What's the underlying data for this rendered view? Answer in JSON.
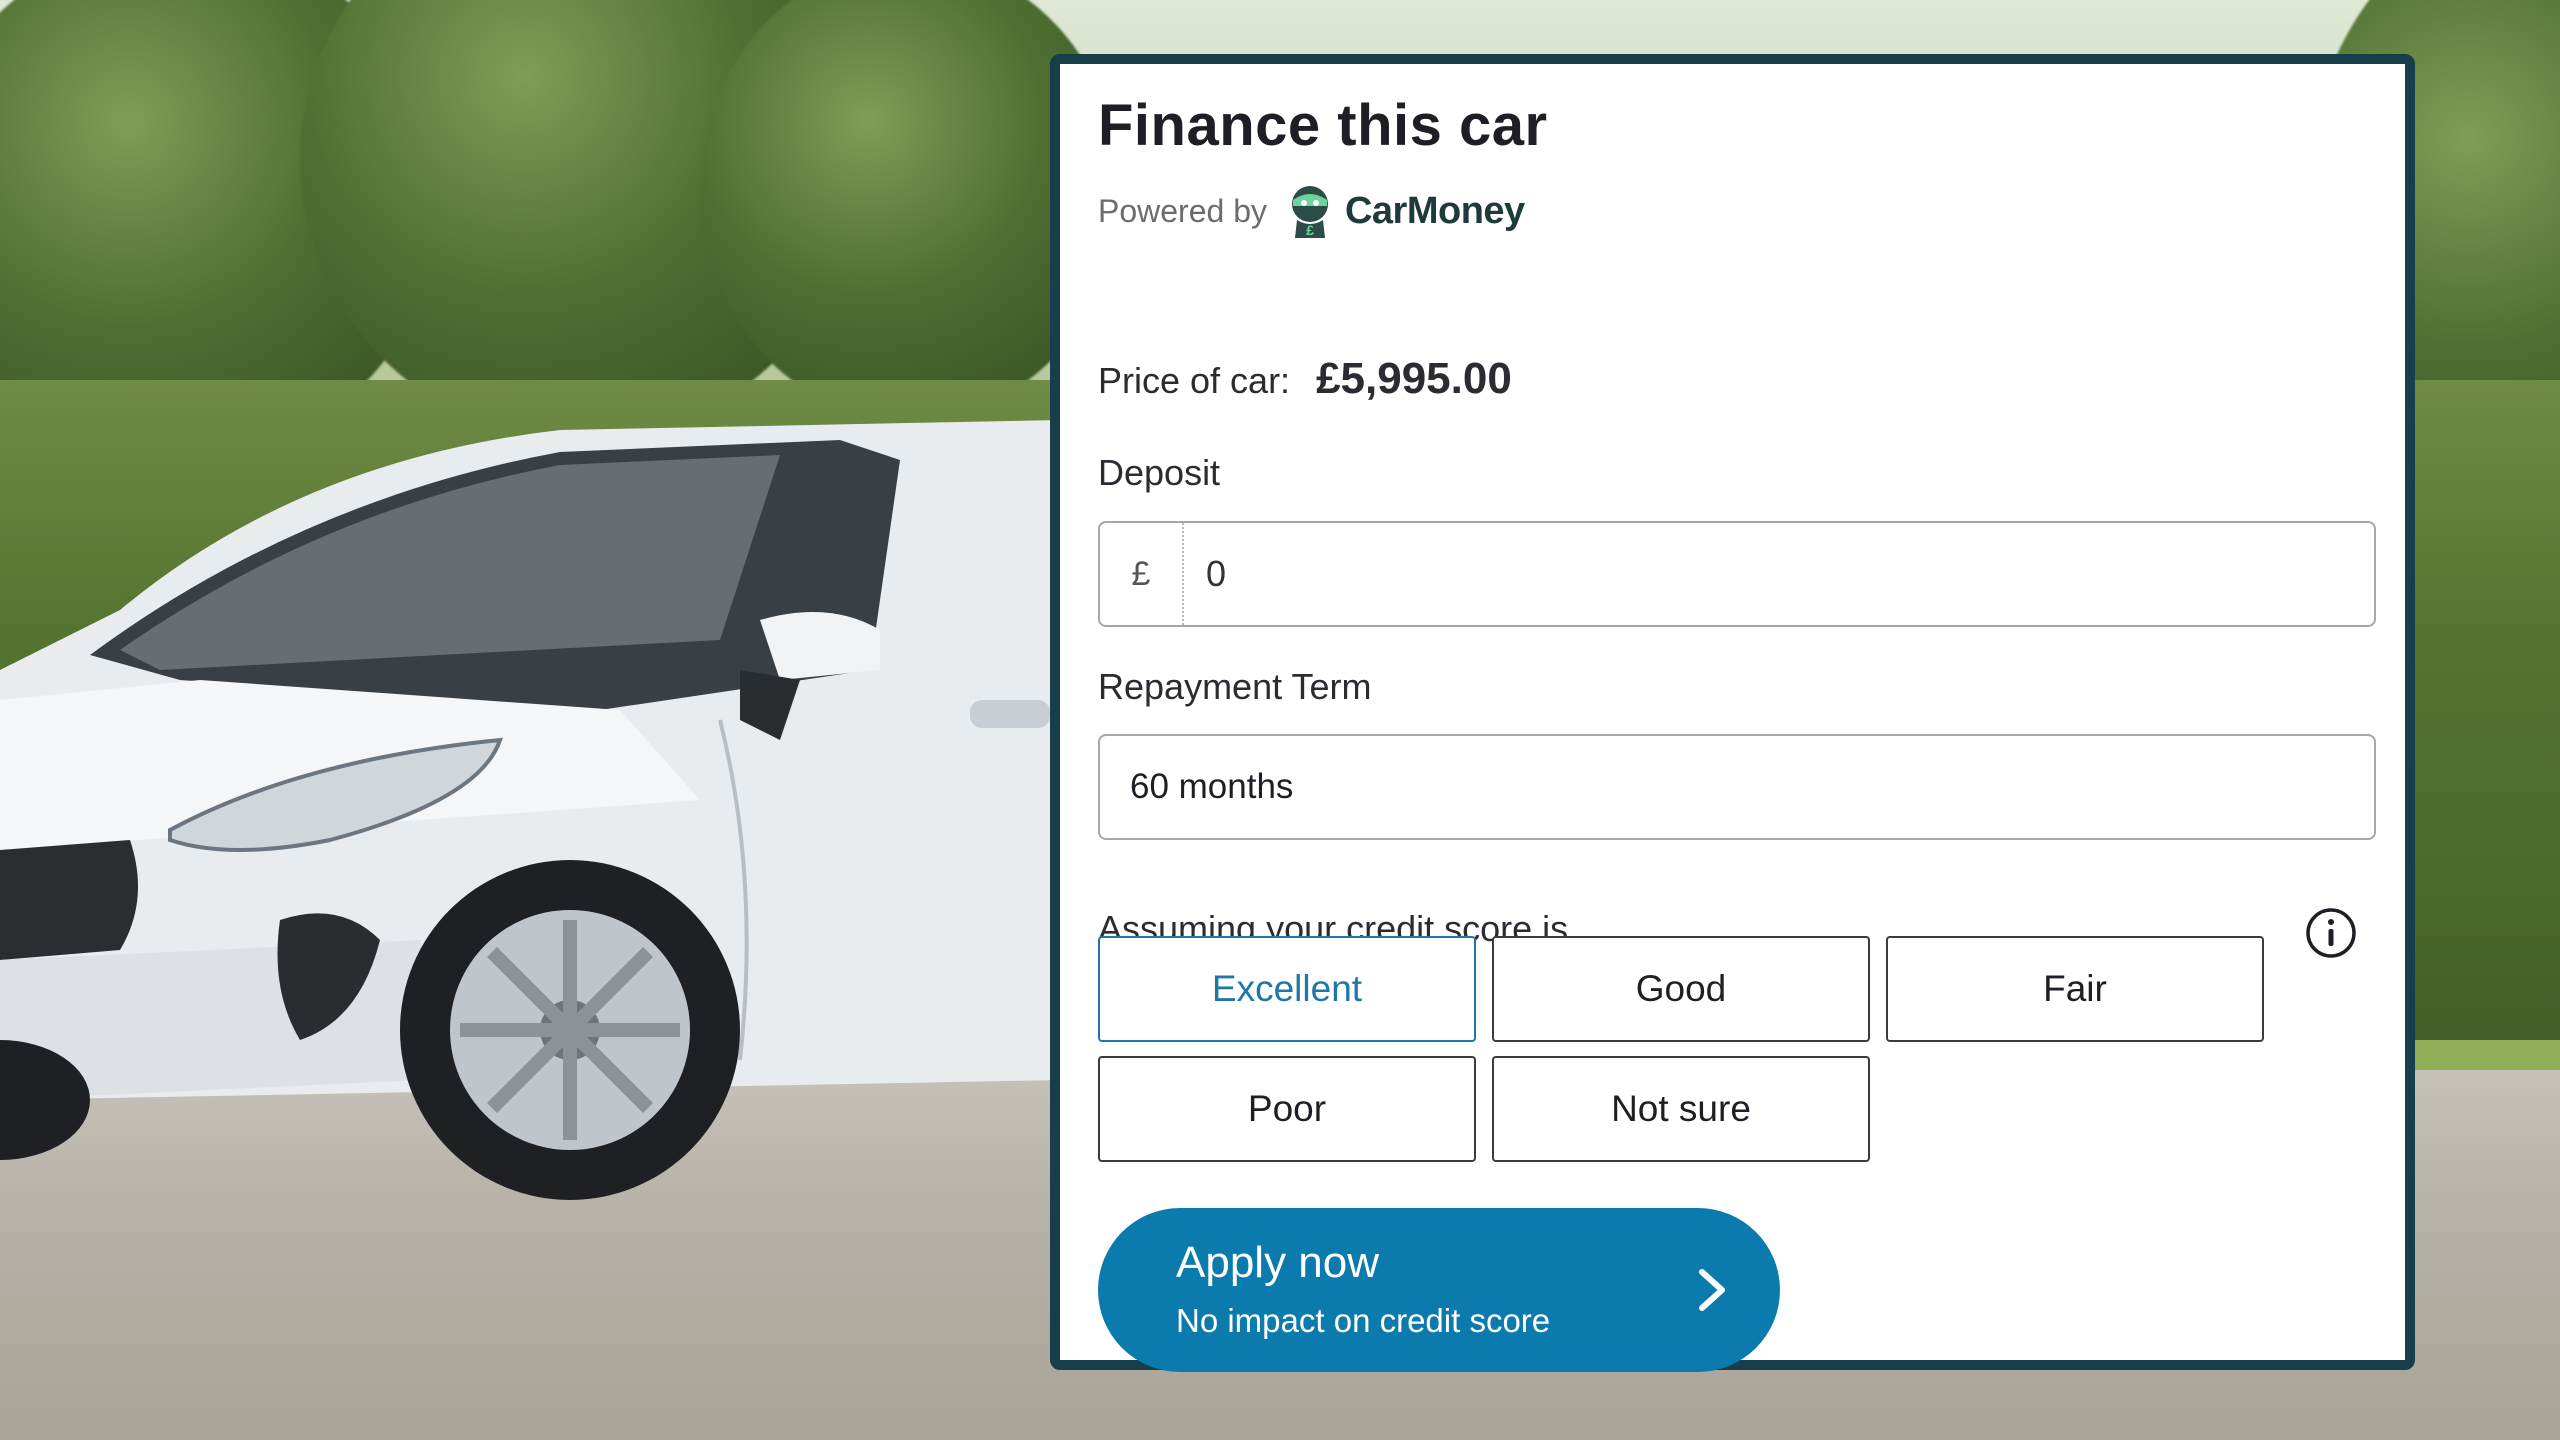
{
  "card": {
    "title": "Finance this car",
    "powered_by": "Powered by",
    "brand_name": "CarMoney",
    "price_label": "Price of car:",
    "price_value": "£5,995.00"
  },
  "deposit": {
    "label": "Deposit",
    "currency_symbol": "£",
    "value": "0"
  },
  "term": {
    "label": "Repayment Term",
    "value": "60 months"
  },
  "credit": {
    "label": "Assuming your credit score is",
    "info_icon": "info-icon",
    "options": [
      "Excellent",
      "Good",
      "Fair",
      "Poor",
      "Not sure"
    ],
    "selected": "Excellent"
  },
  "apply": {
    "title": "Apply now",
    "subtitle": "No impact on credit score",
    "icon": "chevron-right-icon"
  },
  "colors": {
    "card_border": "#173e4a",
    "accent_blue": "#0b7aad",
    "selected_outline": "#1f77a8",
    "brand_green": "#1f3a3a"
  }
}
